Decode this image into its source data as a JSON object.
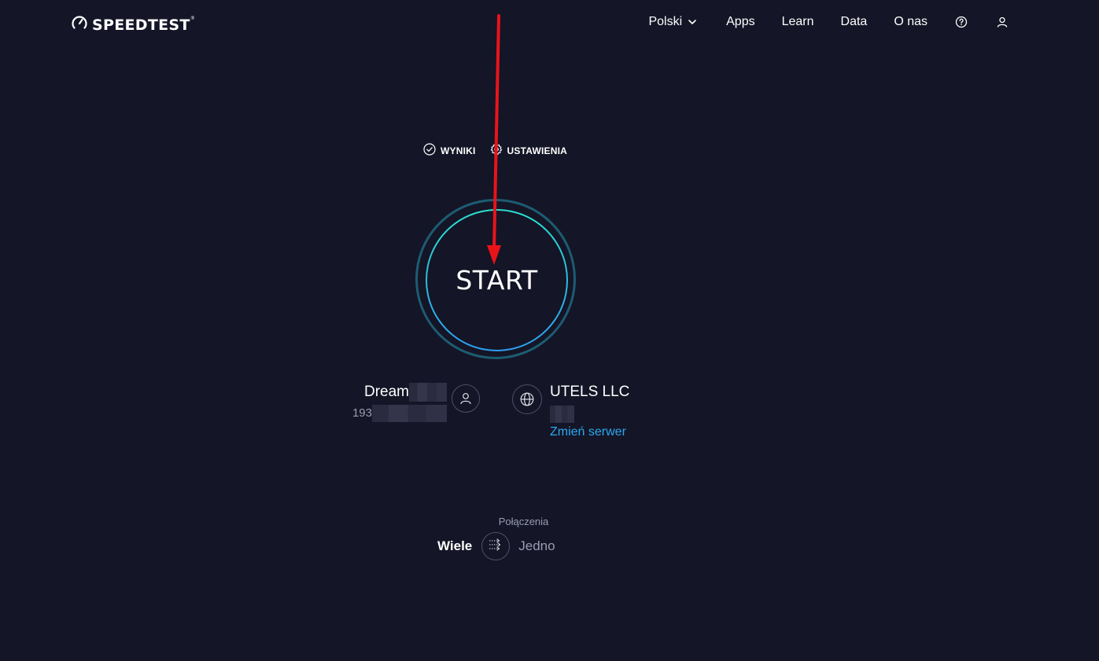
{
  "header": {
    "logo_text": "SPEEDTEST",
    "logo_tm": "®",
    "nav": {
      "language": "Polski",
      "apps": "Apps",
      "learn": "Learn",
      "data": "Data",
      "about": "O nas"
    }
  },
  "subnav": {
    "results": "WYNIKI",
    "settings": "USTAWIENIA"
  },
  "start": {
    "label": "START"
  },
  "isp": {
    "name": "Dream",
    "ip": "193"
  },
  "server": {
    "name": "UTELS LLC",
    "change_label": "Zmień serwer"
  },
  "connections": {
    "label": "Połączenia",
    "multi": "Wiele",
    "single": "Jedno"
  },
  "colors": {
    "background": "#141526",
    "accent_link": "#2aa8f0",
    "start_ring_inner_top": "#2ce0cf",
    "start_ring_inner_bottom": "#2e9ef0",
    "start_ring_outer": "#1d5c72",
    "annotation_arrow": "#e8141a"
  }
}
